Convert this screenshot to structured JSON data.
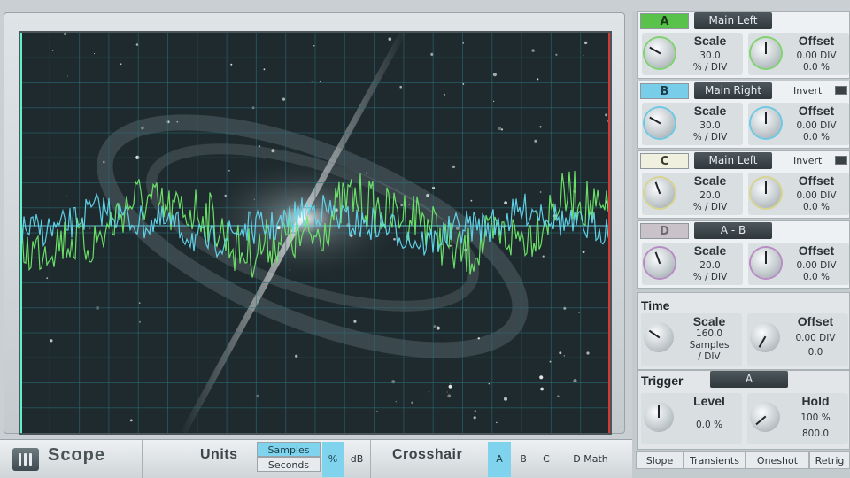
{
  "channels": [
    {
      "letter": "A",
      "source": "Main Left",
      "letter_bg": "#58c24b",
      "letter_color": "#1c3b1a",
      "invert": false,
      "scale": {
        "title": "Scale",
        "value": "30.0",
        "unit": "% / DIV"
      },
      "offset": {
        "title": "Offset",
        "div": "0.00 DIV",
        "pct": "0.0 %"
      },
      "ring_color": "#7ed36f"
    },
    {
      "letter": "B",
      "source": "Main Right",
      "letter_bg": "#78cde8",
      "letter_color": "#1d3f4b",
      "invert": true,
      "invert_label": "Invert",
      "scale": {
        "title": "Scale",
        "value": "30.0",
        "unit": "% / DIV"
      },
      "offset": {
        "title": "Offset",
        "div": "0.00 DIV",
        "pct": "0.0 %"
      },
      "ring_color": "#6cc8e4"
    },
    {
      "letter": "C",
      "source": "Main Left",
      "letter_bg": "#f0f0df",
      "letter_color": "#3a3a2c",
      "invert": true,
      "invert_label": "Invert",
      "scale": {
        "title": "Scale",
        "value": "20.0",
        "unit": "% / DIV"
      },
      "offset": {
        "title": "Offset",
        "div": "0.00 DIV",
        "pct": "0.0 %"
      },
      "ring_color": "#d8d48c"
    },
    {
      "letter": "D",
      "source": "A - B",
      "letter_bg": "#c9c3c9",
      "letter_color": "#6e676e",
      "invert": false,
      "scale": {
        "title": "Scale",
        "value": "20.0",
        "unit": "% / DIV"
      },
      "offset": {
        "title": "Offset",
        "div": "0.00 DIV",
        "pct": "0.0 %"
      },
      "ring_color": "#b78bc3"
    }
  ],
  "time": {
    "title": "Time",
    "scale": {
      "title": "Scale",
      "value": "160.0",
      "unit": "Samples",
      "unit2": "/ DIV"
    },
    "offset": {
      "title": "Offset",
      "div": "0.00 DIV",
      "pct": "0.0"
    }
  },
  "trigger": {
    "title": "Trigger",
    "source": "A",
    "level": {
      "title": "Level",
      "value": "0.0 %"
    },
    "hold": {
      "title": "Hold",
      "pct": "100 %",
      "value": "800.0"
    }
  },
  "trigger_modes": [
    "Slope",
    "Transients",
    "Oneshot",
    "Retrig"
  ],
  "trigger_mode_active": "Slope",
  "bottom": {
    "title": "Scope",
    "units_label": "Units",
    "units_options": [
      "Samples",
      "Seconds"
    ],
    "units_active": "Samples",
    "pct_label": "%",
    "db_label": "dB",
    "crosshair_label": "Crosshair",
    "crosshair_options": [
      "A",
      "B",
      "C"
    ],
    "crosshair_active": "A",
    "dmath_label": "D Math"
  },
  "colors": {
    "accent_blue": "#7fd3ec",
    "trace_green": "#6fe86a",
    "trace_cyan": "#63d8ee",
    "screen_bg": "#1e2a2e",
    "grid": "#2c6f7a"
  },
  "icons": [
    "presonus-logo-icon",
    "knob-icon"
  ]
}
